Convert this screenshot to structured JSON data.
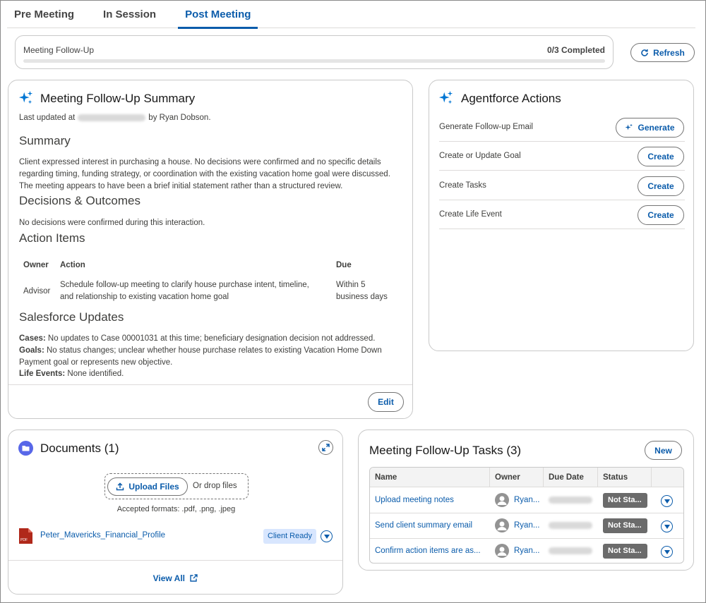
{
  "tabs": [
    "Pre Meeting",
    "In Session",
    "Post Meeting"
  ],
  "active_tab": 2,
  "progress": {
    "label": "Meeting Follow-Up",
    "count_text": "0/3 Completed",
    "fraction": 0
  },
  "refresh_label": "Refresh",
  "summary": {
    "title": "Meeting Follow-Up Summary",
    "updated_prefix": "Last updated at",
    "updated_suffix": "by Ryan Dobson.",
    "summary_heading": "Summary",
    "summary_text": "Client expressed interest in purchasing a house. No decisions were confirmed and no specific details regarding timing, funding strategy, or coordination with the existing vacation home goal were discussed. The meeting appears to have been a brief initial statement rather than a structured review.",
    "decisions_heading": "Decisions & Outcomes",
    "decisions_text": "No decisions were confirmed during this interaction.",
    "action_items_heading": "Action Items",
    "action_table": {
      "headers": [
        "Owner",
        "Action",
        "Due"
      ],
      "rows": [
        {
          "owner": "Advisor",
          "action": "Schedule follow-up meeting to clarify house purchase intent, timeline, and relationship to existing vacation home goal",
          "due": "Within 5 business days"
        }
      ]
    },
    "sf_heading": "Salesforce Updates",
    "sf_updates": [
      {
        "label": "Cases:",
        "text": "No updates to Case 00001031 at this time; beneficiary designation decision not addressed."
      },
      {
        "label": "Goals:",
        "text": "No status changes; unclear whether house purchase relates to existing Vacation Home Down Payment goal or represents new objective."
      },
      {
        "label": "Life Events:",
        "text": "None identified."
      }
    ],
    "edit_label": "Edit"
  },
  "agentforce": {
    "title": "Agentforce Actions",
    "actions": [
      {
        "label": "Generate Follow-up Email",
        "button": "Generate"
      },
      {
        "label": "Create or Update Goal",
        "button": "Create"
      },
      {
        "label": "Create Tasks",
        "button": "Create"
      },
      {
        "label": "Create Life Event",
        "button": "Create"
      }
    ]
  },
  "documents": {
    "title": "Documents (1)",
    "upload_label": "Upload Files",
    "drop_text": "Or drop files",
    "formats": "Accepted formats: .pdf, .png, .jpeg",
    "file_name": "Peter_Mavericks_Financial_Profile",
    "file_badge": "Client Ready",
    "view_all": "View All"
  },
  "tasks": {
    "title": "Meeting Follow-Up Tasks (3)",
    "new_label": "New",
    "headers": [
      "Name",
      "Owner",
      "Due Date",
      "Status"
    ],
    "rows": [
      {
        "name": "Upload meeting notes",
        "owner": "Ryan...",
        "status": "Not Sta..."
      },
      {
        "name": "Send client summary email",
        "owner": "Ryan...",
        "status": "Not Sta..."
      },
      {
        "name": "Confirm action items are as...",
        "owner": "Ryan...",
        "status": "Not Sta..."
      }
    ]
  },
  "colors": {
    "brand_blue": "#0b5cab",
    "sparkle_blue": "#0176d3",
    "status_gray": "#6b6b6b",
    "badge_bg": "#d8e6fe",
    "pdf_red": "#b0281a",
    "folder_purple": "#5867e8"
  }
}
